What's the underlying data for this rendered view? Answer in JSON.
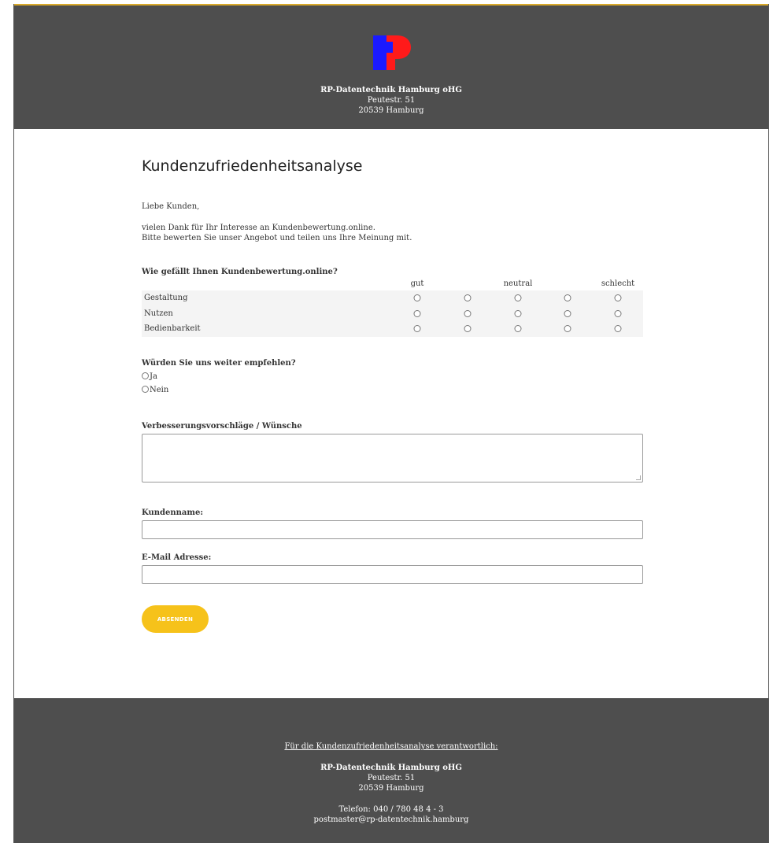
{
  "header": {
    "company": "RP-Datentechnik Hamburg oHG",
    "street": "Peutestr. 51",
    "city": "20539 Hamburg",
    "logo_colors": {
      "blue": "#1a1aff",
      "red": "#ff1a1a"
    }
  },
  "main": {
    "title": "Kundenzufriedenheitsanalyse",
    "greeting": "Liebe Kunden,",
    "intro_line1": "vielen Dank für Ihr Interesse an Kundenbewertung.online.",
    "intro_line2": "Bitte bewerten Sie unser Angebot und teilen uns Ihre Meinung mit."
  },
  "rating": {
    "question": "Wie gefällt Ihnen Kundenbewertung.online?",
    "scale_labels": {
      "low": "gut",
      "mid": "neutral",
      "high": "schlecht"
    },
    "rows": [
      "Gestaltung",
      "Nutzen",
      "Bedienbarkeit"
    ]
  },
  "recommend": {
    "question": "Würden Sie uns weiter empfehlen?",
    "options": [
      "Ja",
      "Nein"
    ]
  },
  "form": {
    "suggestions_label": "Verbesserungsvorschläge / Wünsche",
    "suggestions_value": "",
    "name_label": "Kundenname:",
    "name_value": "",
    "email_label": "E-Mail Adresse:",
    "email_value": "",
    "submit_label": "ABSENDEN",
    "accent_color": "#f6c21a"
  },
  "footer": {
    "responsible": "Für die Kundenzufriedenheitsanalyse verantwortlich:",
    "company": "RP-Datentechnik Hamburg oHG",
    "street": "Peutestr. 51",
    "city": "20539 Hamburg",
    "phone": "Telefon: 040 / 780 48 4 - 3",
    "email": "postmaster@rp-datentechnik.hamburg"
  }
}
